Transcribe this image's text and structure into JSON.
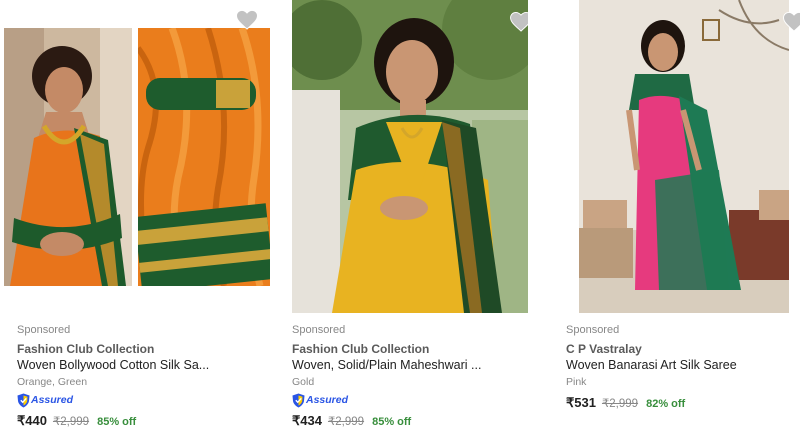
{
  "products": [
    {
      "sponsored": "Sponsored",
      "brand": "Fashion Club Collection",
      "title": "Woven Bollywood Cotton Silk Sa...",
      "colors": "Orange, Green",
      "assured": "Assured",
      "price": "₹440",
      "mrp": "₹2,999",
      "discount": "85% off",
      "image": "orange-green-saree-photo"
    },
    {
      "sponsored": "Sponsored",
      "brand": "Fashion Club Collection",
      "title": "Woven, Solid/Plain Maheshwari ...",
      "colors": "Gold",
      "assured": "Assured",
      "price": "₹434",
      "mrp": "₹2,999",
      "discount": "85% off",
      "image": "gold-saree-photo"
    },
    {
      "sponsored": "Sponsored",
      "brand": "C P Vastralay",
      "title": "Woven Banarasi Art Silk Saree",
      "colors": "Pink",
      "price": "₹531",
      "mrp": "₹2,999",
      "discount": "82% off",
      "image": "pink-banarasi-saree-photo"
    }
  ],
  "icons": {
    "wishlist": "heart-icon",
    "assured": "assured-shield-icon"
  },
  "colors": {
    "discount": "#388e3c",
    "assured": "#2a55e5",
    "muted": "#878787"
  }
}
